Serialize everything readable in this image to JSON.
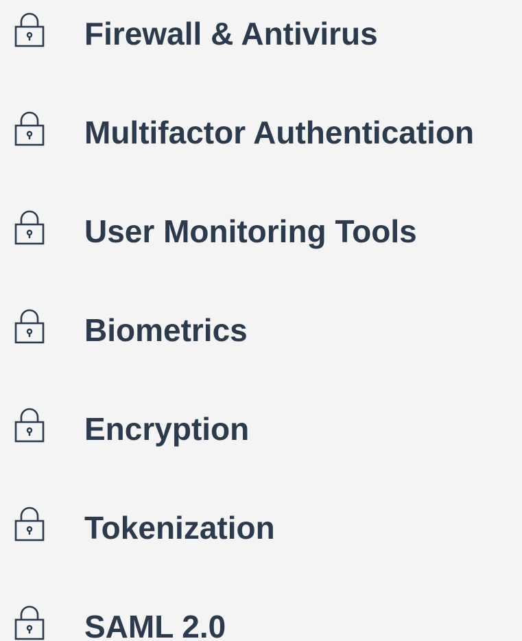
{
  "features": {
    "icon": "lock-icon",
    "text_color": "#2c3a4d",
    "icon_color": "#2c3a4d",
    "background": "#f4f4f4",
    "items": [
      {
        "label": "Firewall & Antivirus"
      },
      {
        "label": "Multifactor Authentication"
      },
      {
        "label": "User Monitoring Tools"
      },
      {
        "label": "Biometrics"
      },
      {
        "label": "Encryption"
      },
      {
        "label": "Tokenization"
      },
      {
        "label": "SAML 2.0"
      }
    ]
  }
}
